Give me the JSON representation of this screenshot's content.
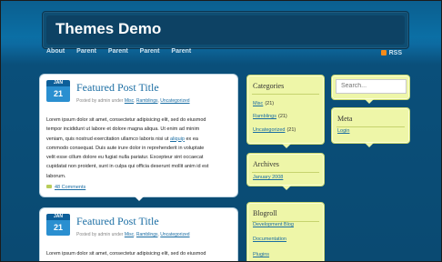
{
  "site": {
    "title": "Themes Demo"
  },
  "nav": {
    "items": [
      "About",
      "Parent",
      "Parent",
      "Parent",
      "Parent"
    ],
    "rss_label": "RSS"
  },
  "posts": [
    {
      "month": "JAN",
      "day": "21",
      "title": "Featured Post Title",
      "meta_prefix": "Posted by admin under",
      "categories": [
        "Misc",
        "Ramblings",
        "Uncategorized"
      ],
      "body_lines": [
        "Lorem ipsum dolor sit amet, consectetur adipisicing elit, sed do eiusmod",
        "tempor incididunt ut labore et dolore magna aliqua. Ut enim ad minim",
        "veniam, quis nostrud exercitation ullamco laboris nisi ut",
        "commodo consequat. Duis aute irure dolor in reprehenderit in voluptate",
        "velit esse cillum dolore eu fugiat nulla pariatur. Excepteur sint occaecat",
        "cupidatat non proident, sunt in culpa qui officia deserunt mollit anim id est",
        "laborum."
      ],
      "inline_link": "aliquip",
      "line3_tail": "ex ea",
      "comments": "48 Comments"
    },
    {
      "month": "JAN",
      "day": "21",
      "title": "Featured Post Title",
      "meta_prefix": "Posted by admin under",
      "categories": [
        "Misc",
        "Ramblings",
        "Uncategorized"
      ],
      "body_lines": [
        "Lorem ipsum dolor sit amet, consectetur adipisicing elit, sed do eiusmod"
      ]
    }
  ],
  "sidebar": {
    "categories": {
      "title": "Categories",
      "items": [
        {
          "label": "Misc",
          "count": "(21)"
        },
        {
          "label": "Ramblings",
          "count": "(21)"
        },
        {
          "label": "Uncategorized",
          "count": "(21)"
        }
      ]
    },
    "archives": {
      "title": "Archives",
      "items": [
        "January 2008"
      ]
    },
    "blogroll": {
      "title": "Blogroll",
      "items": [
        "Development Blog",
        "Documentation",
        "Plugins"
      ]
    },
    "search": {
      "placeholder": "Search..."
    },
    "meta": {
      "title": "Meta",
      "items": [
        "Login"
      ]
    }
  },
  "colors": {
    "background": "#0d5a85",
    "header": "#0d4264",
    "sidebar_box": "#eef6a8",
    "link": "#1a6da3",
    "date_badge": "#2a8fd0"
  }
}
